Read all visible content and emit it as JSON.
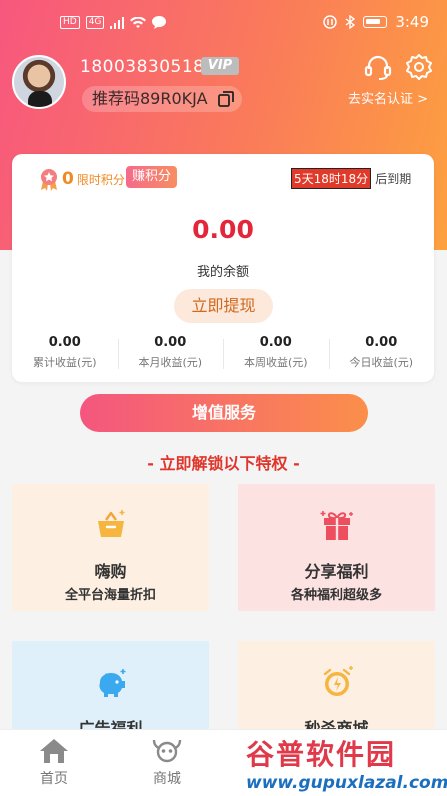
{
  "status_bar": {
    "left_chips": [
      "HD",
      "4G"
    ],
    "time": "3:49"
  },
  "profile": {
    "phone": "18003830518",
    "vip_badge": "VIP",
    "referral_code": "推荐码89R0KJA",
    "realname_link": "去实名认证 >"
  },
  "points": {
    "value": "0",
    "label": "限时积分",
    "earn_button": "赚积分"
  },
  "expiry": {
    "remaining": "5天18时18分",
    "suffix": "后到期"
  },
  "balance": {
    "amount": "0.00",
    "label": "我的余额",
    "withdraw_button": "立即提现"
  },
  "stats": [
    {
      "value": "0.00",
      "label": "累计收益(元)"
    },
    {
      "value": "0.00",
      "label": "本月收益(元)"
    },
    {
      "value": "0.00",
      "label": "本周收益(元)"
    },
    {
      "value": "0.00",
      "label": "今日收益(元)"
    }
  ],
  "value_added_button": "增值服务",
  "unlock_heading": "- 立即解锁以下特权 -",
  "tiles": [
    {
      "title": "嗨购",
      "subtitle": "全平台海量折扣",
      "icon": "basket-icon"
    },
    {
      "title": "分享福利",
      "subtitle": "各种福利超级多",
      "icon": "gift-icon"
    },
    {
      "title": "广告福利",
      "subtitle": "",
      "icon": "piggy-bank-icon"
    },
    {
      "title": "秒杀商城",
      "subtitle": "",
      "icon": "alarm-clock-icon"
    }
  ],
  "tabbar": {
    "home": "首页",
    "mall": "商城"
  },
  "watermark": {
    "top": "谷普软件园",
    "bottom": "www.gupuxlazal.com"
  },
  "colors": {
    "accent_pink": "#f7577e",
    "accent_orange": "#fda13f",
    "price_red": "#e4263a"
  }
}
